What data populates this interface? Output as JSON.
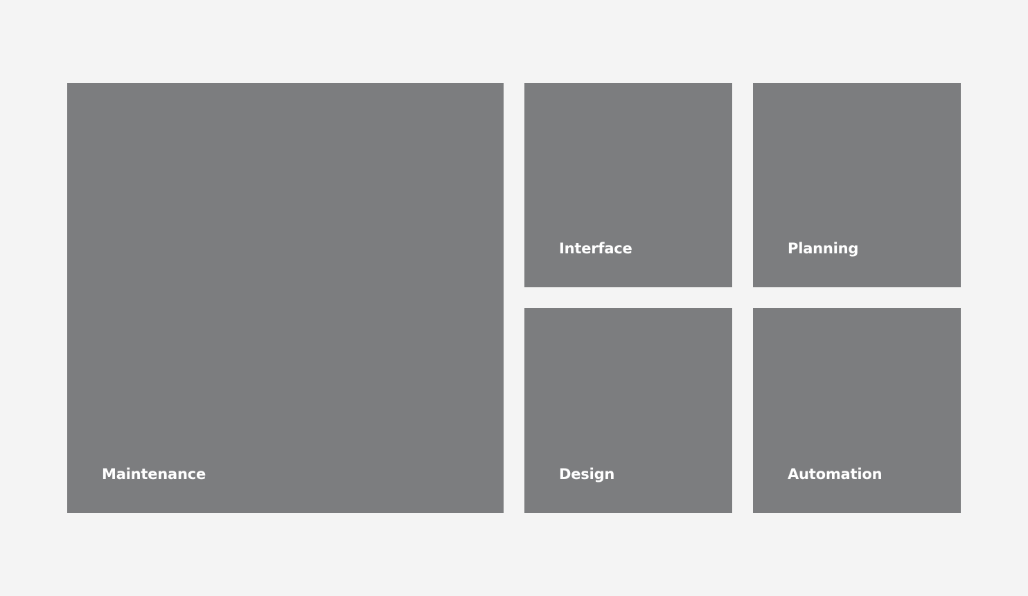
{
  "tiles": [
    {
      "label": "Maintenance"
    },
    {
      "label": "Interface"
    },
    {
      "label": "Planning"
    },
    {
      "label": "Design"
    },
    {
      "label": "Automation"
    }
  ],
  "colors": {
    "background": "#f4f4f4",
    "tile": "#7c7d7f",
    "label": "#ffffff"
  }
}
